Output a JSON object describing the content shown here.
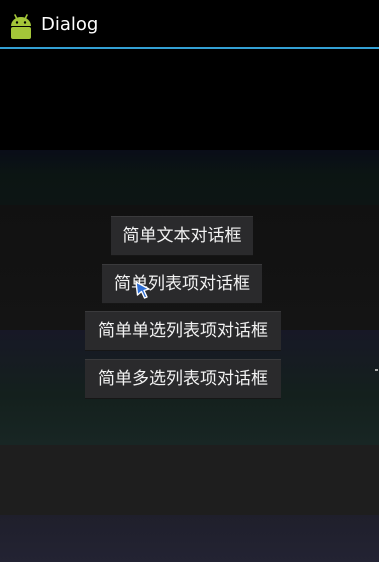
{
  "action_bar": {
    "title": "Dialog",
    "icon": "android-robot-icon",
    "accent_color": "#33a0d4"
  },
  "buttons": [
    {
      "label": "简单文本对话框"
    },
    {
      "label": "简单列表项对话框"
    },
    {
      "label": "简单单选列表项对话框"
    },
    {
      "label": "简单多选列表项对话框"
    }
  ],
  "cursor": {
    "icon": "hand-pointer-icon"
  }
}
